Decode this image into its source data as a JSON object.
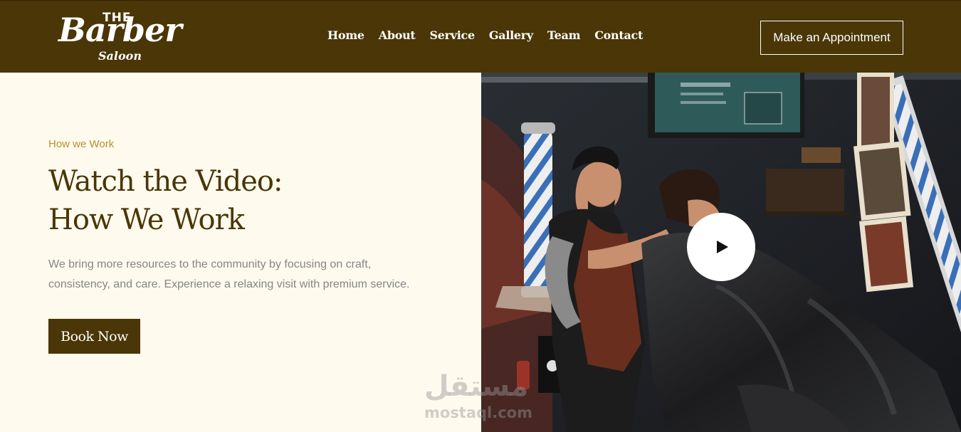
{
  "header": {
    "logo": {
      "top": "THE",
      "brand": "Barber",
      "sub": "Saloon"
    },
    "nav": [
      "Home",
      "About",
      "Service",
      "Gallery",
      "Team",
      "Contact"
    ],
    "cta_label": "Make an Appointment"
  },
  "hero": {
    "eyebrow": "How we Work",
    "headline_line1": "Watch the Video:",
    "headline_line2": "How We Work",
    "description": "We bring more resources to the community by focusing on craft, consistency, and care. Experience a relaxing visit with premium service.",
    "button_label": "Book Now"
  },
  "video": {
    "play_icon": "play-icon"
  },
  "watermark": {
    "arabic": "مستقل",
    "latin": "mostaql.com"
  },
  "colors": {
    "brand_brown": "#4a3606",
    "accent_gold": "#b8902e",
    "cream": "#fffaee"
  }
}
